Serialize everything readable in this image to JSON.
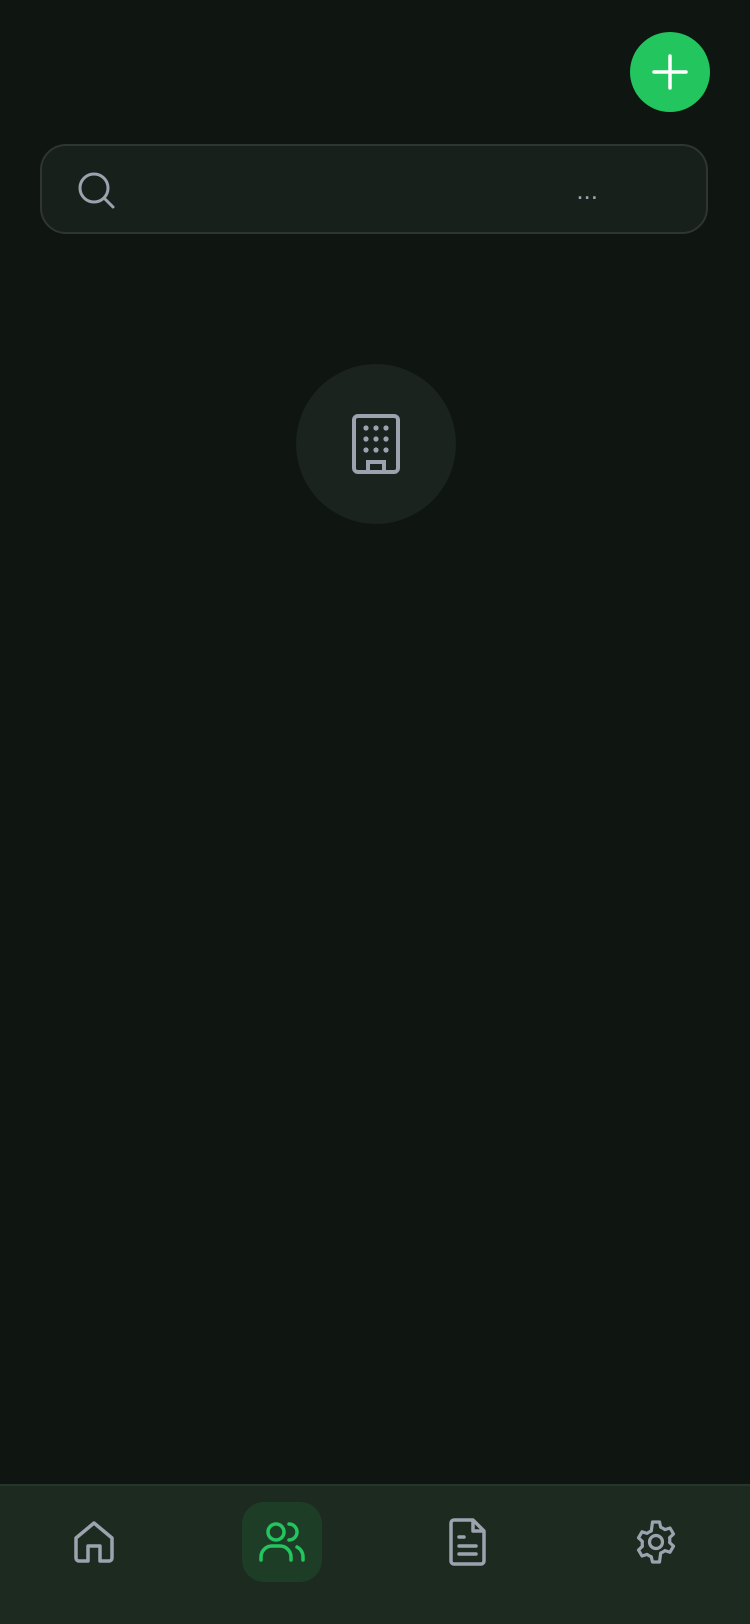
{
  "header": {
    "add_button": {
      "icon": "plus-icon",
      "color": "#22c55e"
    }
  },
  "search": {
    "icon": "search-icon",
    "placeholder": "...",
    "value": ""
  },
  "empty_state": {
    "icon": "building-icon"
  },
  "bottom_nav": {
    "items": [
      {
        "id": "home",
        "icon": "home-icon",
        "active": false
      },
      {
        "id": "contacts",
        "icon": "users-icon",
        "active": true
      },
      {
        "id": "documents",
        "icon": "document-icon",
        "active": false
      },
      {
        "id": "settings",
        "icon": "gear-icon",
        "active": false
      }
    ]
  },
  "colors": {
    "background": "#0f1510",
    "accent": "#22c55e",
    "nav_background": "#1c2a1f",
    "icon_inactive": "#9ca3af"
  }
}
